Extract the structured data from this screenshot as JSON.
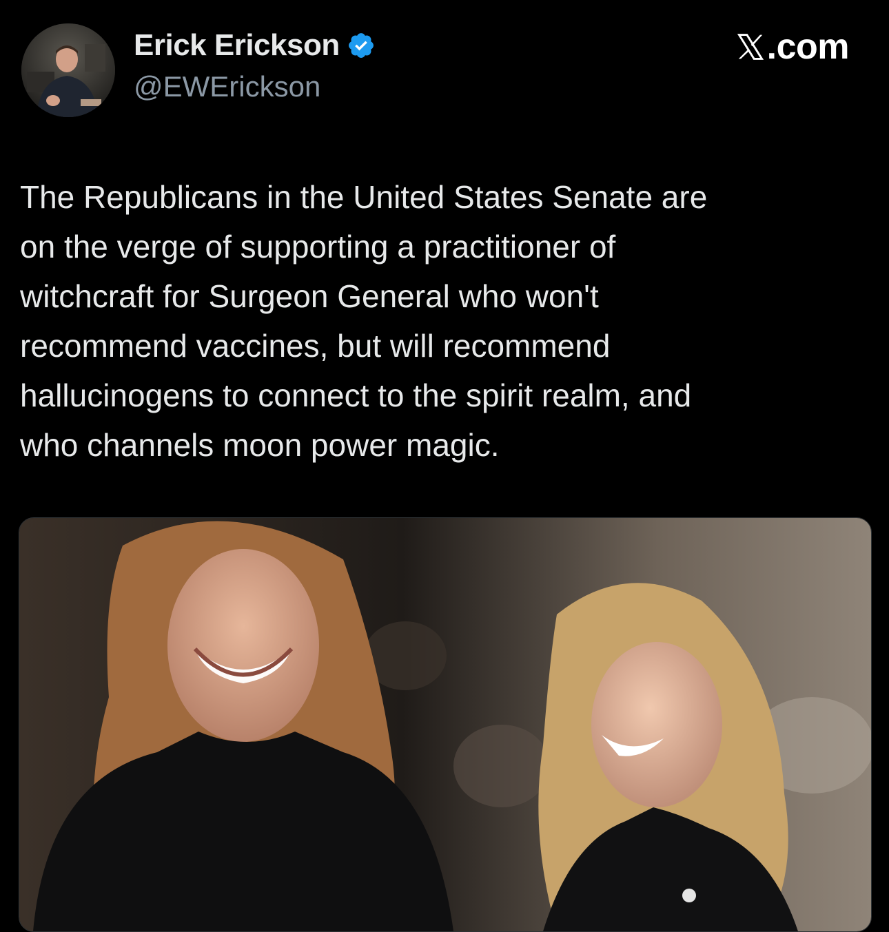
{
  "author": {
    "display_name": "Erick Erickson",
    "handle": "@EWErickson",
    "verified": true,
    "avatar_icon": "avatar-photo"
  },
  "brand": {
    "text": ".com",
    "logo_icon": "x-logo-icon"
  },
  "tweet": {
    "text": "The Republicans in the United States Senate are\non the verge of supporting a practitioner of\nwitchcraft for Surgeon General who won't\nrecommend vaccines, but will recommend\nhallucinogens to connect to the spirit realm, and\nwho channels moon power magic."
  },
  "media": {
    "type": "photo",
    "icon": "photo-two-women-smiling"
  },
  "colors": {
    "background": "#000000",
    "text_primary": "#e7e9ea",
    "text_secondary": "#8b98a5",
    "verified_blue": "#1d9bf0"
  }
}
